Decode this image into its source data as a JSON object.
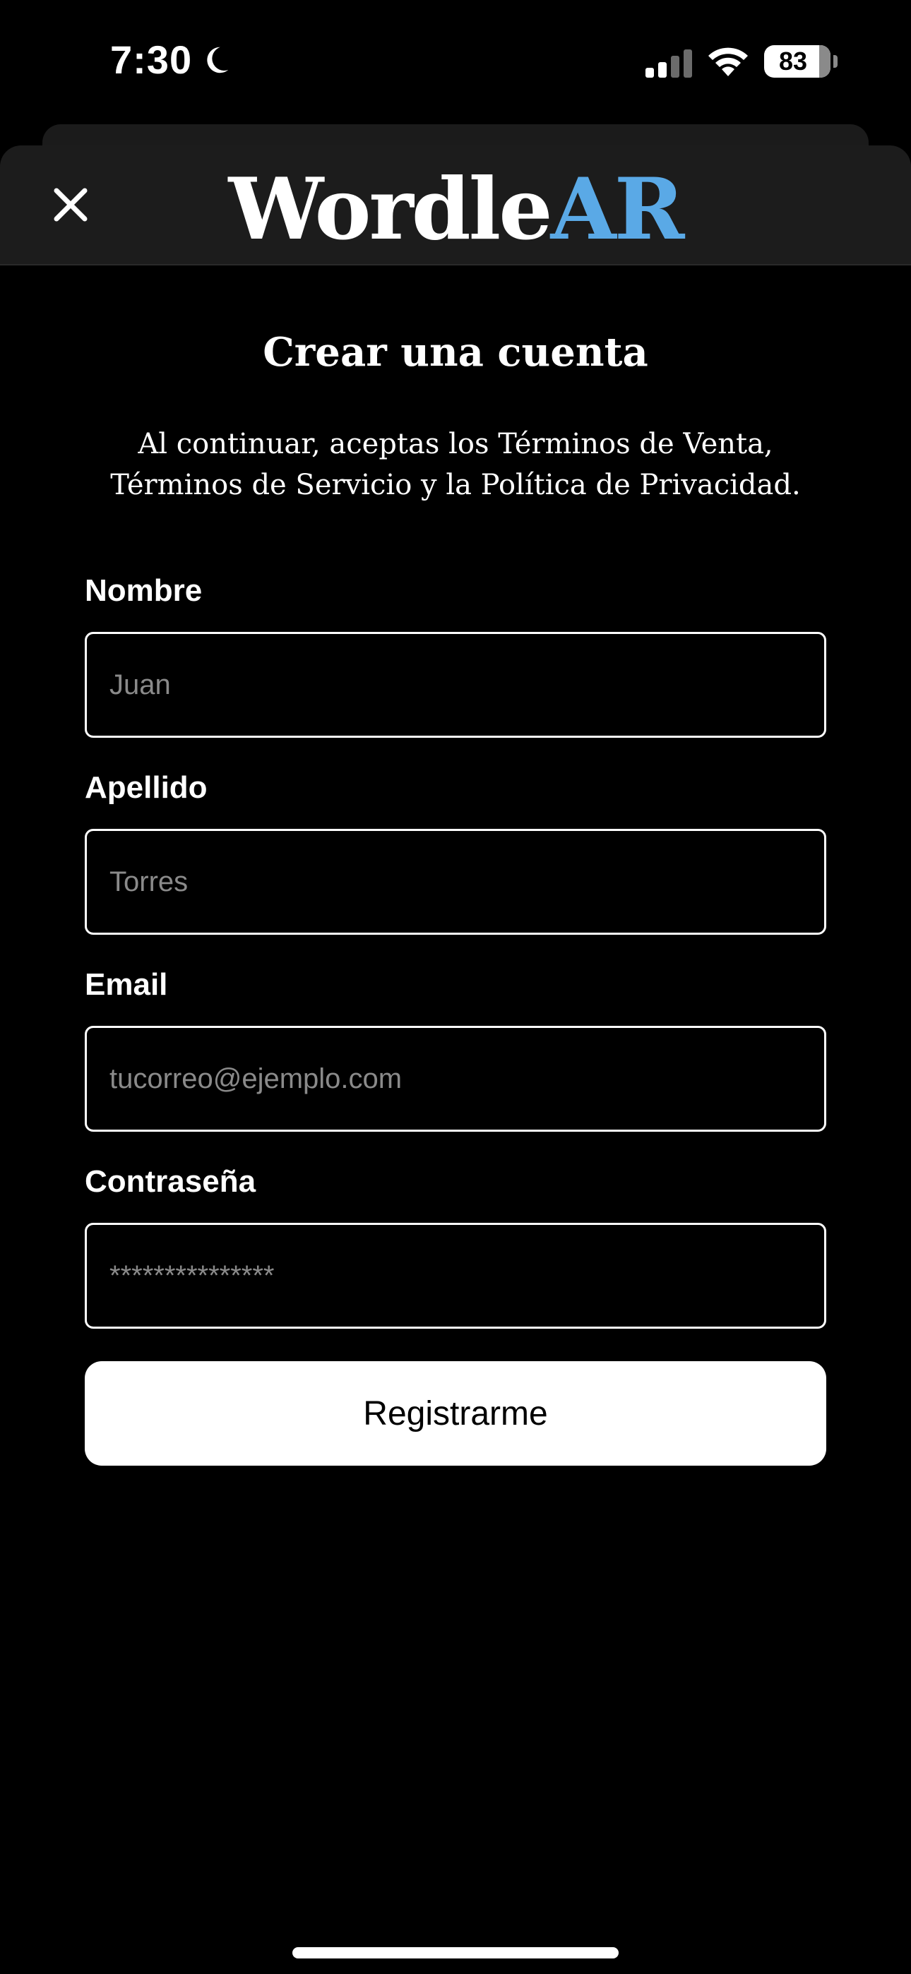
{
  "status_bar": {
    "time": "7:30",
    "battery": "83"
  },
  "header": {
    "logo_main": "Wordle",
    "logo_accent": "AR",
    "accent_color": "#5aa9e6"
  },
  "form": {
    "title": "Crear una cuenta",
    "subtitle": "Al continuar, aceptas los Términos de Venta, Términos de Servicio y la Política de Privacidad.",
    "fields": [
      {
        "label": "Nombre",
        "placeholder": "Juan"
      },
      {
        "label": "Apellido",
        "placeholder": "Torres"
      },
      {
        "label": "Email",
        "placeholder": "tucorreo@ejemplo.com"
      },
      {
        "label": "Contraseña",
        "placeholder": "***************"
      }
    ],
    "submit_label": "Registrarme"
  },
  "icons": {
    "close": "close-icon",
    "moon": "moon-icon",
    "signal": "cellular-signal-icon",
    "wifi": "wifi-icon",
    "battery": "battery-icon"
  }
}
